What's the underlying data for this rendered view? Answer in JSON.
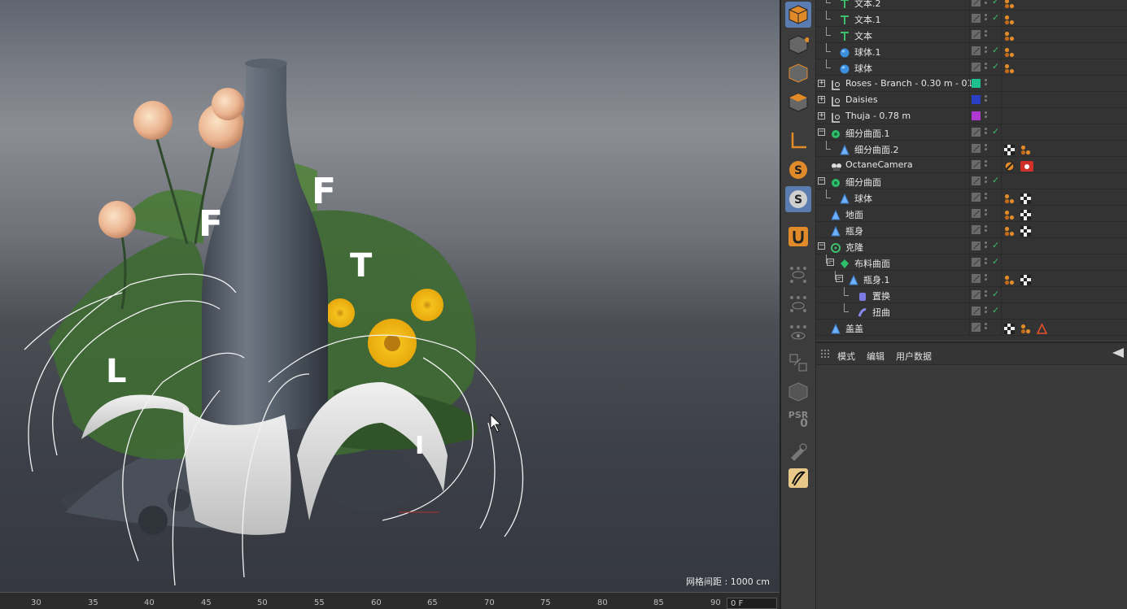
{
  "viewport": {
    "grid_spacing_label": "网格间距 : 1000 cm",
    "scene_letters": [
      "F",
      "F",
      "T",
      "L",
      "L",
      "I"
    ]
  },
  "timeline": {
    "ticks": [
      "30",
      "35",
      "40",
      "45",
      "50",
      "55",
      "60",
      "65",
      "70",
      "75",
      "80",
      "85",
      "90"
    ],
    "current_frame": "0 F"
  },
  "toolbar": {
    "items": [
      "model-mode",
      "points-mode",
      "edges-mode",
      "polygons-mode",
      "axis-tool",
      "snap",
      "snap-settings",
      "magnet",
      "view-grid-1",
      "view-grid-2",
      "view-grid-3",
      "texture-mode",
      "workplane",
      "psr",
      "paint",
      "sketch"
    ],
    "psr_label": "PSR",
    "psr_value": "0"
  },
  "object_manager": {
    "rows": [
      {
        "name": "文本.2",
        "icon": "text-icon",
        "indent": 1,
        "tags": [
          "phong"
        ],
        "check": true
      },
      {
        "name": "文本.1",
        "icon": "text-icon",
        "indent": 1,
        "tags": [
          "phong"
        ],
        "check": true
      },
      {
        "name": "文本",
        "icon": "text-icon",
        "indent": 1,
        "tags": [
          "phong"
        ],
        "check": false
      },
      {
        "name": "球体.1",
        "icon": "sphere-icon",
        "indent": 1,
        "tags": [
          "phong"
        ],
        "check": true
      },
      {
        "name": "球体",
        "icon": "sphere-icon",
        "indent": 1,
        "tags": [
          "phong"
        ],
        "check": true
      },
      {
        "name": "Roses - Branch - 0.30 m - 01",
        "icon": "null-icon",
        "indent": 0,
        "expand": "+",
        "swatch": "#1fbf8f",
        "tags": [],
        "check": false
      },
      {
        "name": "Daisies",
        "icon": "null-icon",
        "indent": 0,
        "expand": "+",
        "swatch": "#2a3fc4",
        "tags": [],
        "check": false
      },
      {
        "name": "Thuja - 0.78 m",
        "icon": "null-icon",
        "indent": 0,
        "expand": "+",
        "swatch": "#b03ad1",
        "tags": [],
        "check": false
      },
      {
        "name": "细分曲面.1",
        "icon": "subdiv-icon",
        "indent": 0,
        "expand": "-",
        "tags": [],
        "check": true
      },
      {
        "name": "细分曲面.2",
        "icon": "poly-icon",
        "indent": 1,
        "tags": [
          "checker",
          "phong"
        ],
        "check": false
      },
      {
        "name": "OctaneCamera",
        "icon": "camera-icon",
        "indent": 0,
        "tags": [
          "forbidden",
          "octane-camera"
        ],
        "check": false
      },
      {
        "name": "细分曲面",
        "icon": "subdiv-icon",
        "indent": 0,
        "expand": "-",
        "tags": [],
        "check": true
      },
      {
        "name": "球体",
        "icon": "poly-icon",
        "indent": 1,
        "tags": [
          "phong",
          "checker"
        ],
        "check": false
      },
      {
        "name": "地面",
        "icon": "poly-icon",
        "indent": 0,
        "tags": [
          "phong",
          "checker"
        ],
        "check": false
      },
      {
        "name": "瓶身",
        "icon": "poly-icon",
        "indent": 0,
        "tags": [
          "phong",
          "checker"
        ],
        "check": false
      },
      {
        "name": "克隆",
        "icon": "cloner-icon",
        "indent": 0,
        "expand": "-",
        "tags": [],
        "check": true
      },
      {
        "name": "布料曲面",
        "icon": "cloth-icon",
        "indent": 1,
        "expand": "-",
        "tags": [],
        "check": true
      },
      {
        "name": "瓶身.1",
        "icon": "poly-icon",
        "indent": 2,
        "expand": "-",
        "tags": [
          "phong",
          "checker"
        ],
        "check": false
      },
      {
        "name": "置换",
        "icon": "displace-icon",
        "indent": 3,
        "tags": [],
        "check": true
      },
      {
        "name": "扭曲",
        "icon": "twist-icon",
        "indent": 3,
        "tags": [],
        "check": true
      },
      {
        "name": "盖盖",
        "icon": "poly-icon",
        "indent": 0,
        "tags": [
          "checker",
          "phong",
          "warning"
        ],
        "check": false
      }
    ]
  },
  "attributes": {
    "menu": [
      "模式",
      "编辑",
      "用户数据"
    ]
  },
  "colors": {
    "accent": "#5b7cb0",
    "check": "#39c16b",
    "phong": "#e08a2a",
    "warning": "#e8502a"
  }
}
